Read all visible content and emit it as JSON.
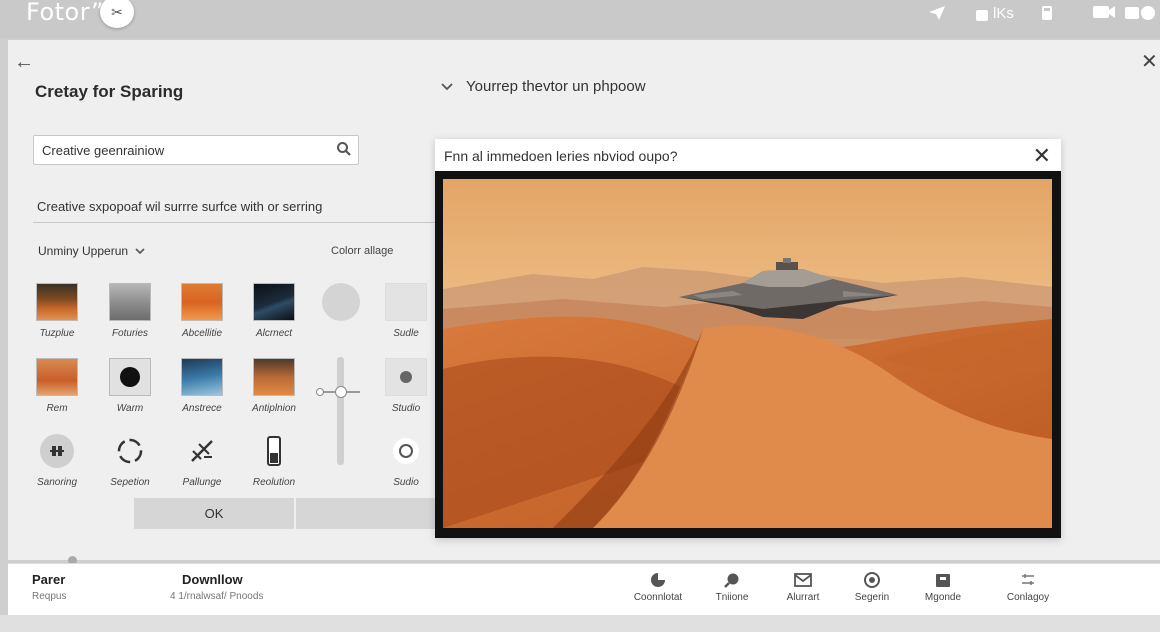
{
  "app": {
    "logo": "Fotor”"
  },
  "topbar": {
    "lks_label": "lKs"
  },
  "header": {
    "title": "Cretay for Sparing",
    "subtitle": "Yourrep thevtor un phpoow"
  },
  "search": {
    "value": "Creative geenrainiow",
    "placeholder": ""
  },
  "description": "Creative sxpopoaf wil surrre surfce with or serring",
  "dropdown": {
    "label": "Unminy Upperun"
  },
  "color_label": "Colorr allage",
  "grid": {
    "row1": [
      "Tuzplue",
      "Foturies",
      "Abcellitie",
      "Alcrnect",
      "Sudle"
    ],
    "row2": [
      "Rem",
      "Warm",
      "Anstrece",
      "Antiplnion",
      "Studio"
    ],
    "row3": [
      "Sanoring",
      "Sepetion",
      "Pallunge",
      "Reolution",
      "Sudio"
    ]
  },
  "ok_button": "OK",
  "dialog": {
    "title": "Fnn al immedoen leries nbviod oupo?"
  },
  "bottom": {
    "left_main": "Parer",
    "left_sub": "Reqpus",
    "center_main": "Downllow",
    "center_sub": "4 1/rnalwsaf/ Pnoods",
    "tools": [
      "Coonnlotat",
      "Tniione",
      "Alurrart",
      "Segerin",
      "Mgonde",
      "Conlagoy"
    ]
  },
  "colors": {
    "panel": "#efefef",
    "sky": "#e8b172",
    "dune": "#c8672c",
    "frame": "#111111"
  }
}
